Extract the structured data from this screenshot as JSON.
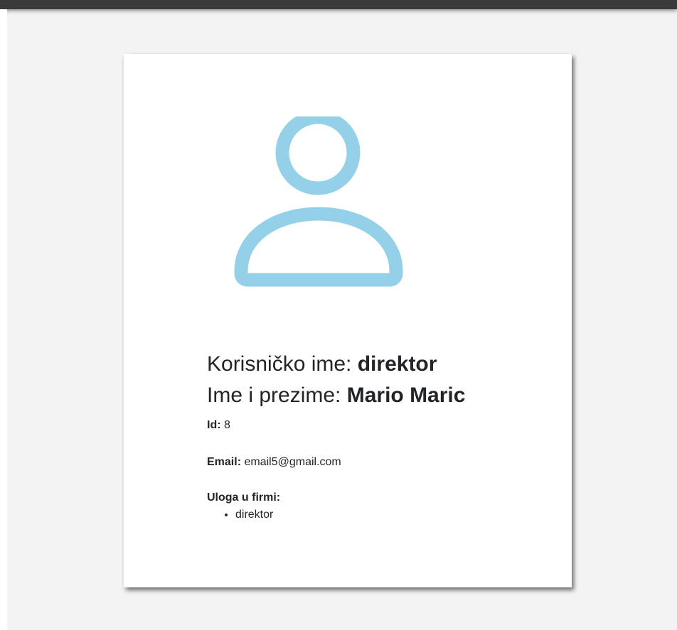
{
  "profile": {
    "username_label": "Korisničko ime: ",
    "username_value": "direktor",
    "fullname_label": "Ime i prezime: ",
    "fullname_value": "Mario Maric",
    "id_label": "Id:",
    "id_value": " 8",
    "email_label": "Email:",
    "email_value": " email5@gmail.com",
    "role_label": "Uloga u firmi:",
    "roles": [
      "direktor"
    ]
  },
  "avatar": {
    "icon": "user-icon",
    "color": "#94d1e9"
  },
  "colors": {
    "page_background": "#f3f3f3",
    "top_bar": "#3a3a3a",
    "card_background": "#ffffff",
    "text": "#212529"
  }
}
